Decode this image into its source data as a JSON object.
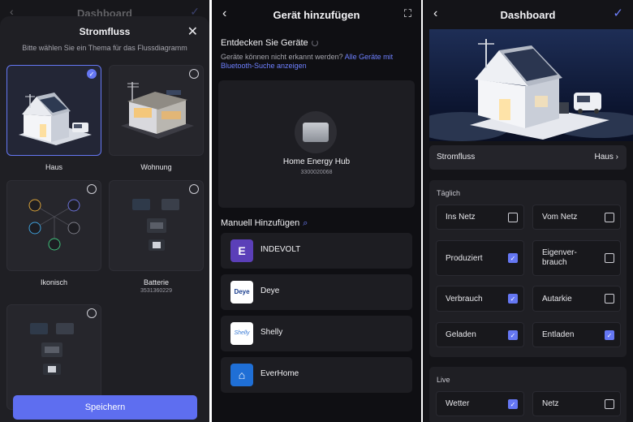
{
  "panel1": {
    "bg_title": "Dashboard",
    "sheet_title": "Stromfluss",
    "sheet_subtitle": "Bitte wählen Sie ein Thema für das Flussdiagramm",
    "tiles": [
      {
        "label": "Haus",
        "selected": true
      },
      {
        "label": "Wohnung",
        "selected": false
      },
      {
        "label": "Ikonisch",
        "selected": false
      },
      {
        "label": "Batterie",
        "sub": "3531360229",
        "selected": false
      },
      {
        "label": "",
        "selected": false
      }
    ],
    "save_label": "Speichern"
  },
  "panel2": {
    "title": "Gerät hinzufügen",
    "discover_title": "Entdecken Sie Geräte",
    "discover_note": "Geräte können nicht erkannt werden?",
    "discover_link": "Alle Geräte mit Bluetooth-Suche anzeigen",
    "hub_name": "Home Energy Hub",
    "hub_serial": "3300020068",
    "manual_title": "Manuell Hinzufügen",
    "brands": [
      {
        "name": "INDEVOLT",
        "logo": "E",
        "color": "#5b3fb8"
      },
      {
        "name": "Deye",
        "logo": "Deye",
        "color": "#ffffff"
      },
      {
        "name": "Shelly",
        "logo": "Shelly",
        "color": "#ffffff"
      },
      {
        "name": "EverHome",
        "logo": "⌂",
        "color": "#1f6fd6"
      }
    ]
  },
  "panel3": {
    "title": "Dashboard",
    "stromfluss_label": "Stromfluss",
    "stromfluss_value": "Haus",
    "daily_title": "Täglich",
    "daily": [
      {
        "label": "Ins Netz",
        "checked": false
      },
      {
        "label": "Vom Netz",
        "checked": false
      },
      {
        "label": "Produziert",
        "checked": true
      },
      {
        "label": "Eigenver-\nbrauch",
        "checked": false
      },
      {
        "label": "Verbrauch",
        "checked": true
      },
      {
        "label": "Autarkie",
        "checked": false
      },
      {
        "label": "Geladen",
        "checked": true
      },
      {
        "label": "Entladen",
        "checked": true
      }
    ],
    "live_title": "Live",
    "live": [
      {
        "label": "Wetter",
        "checked": true
      },
      {
        "label": "Netz",
        "checked": false
      }
    ]
  }
}
